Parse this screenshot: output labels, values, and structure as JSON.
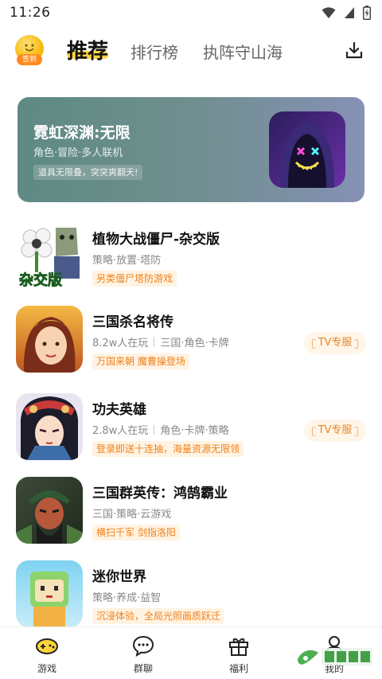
{
  "status_bar": {
    "time": "11:26",
    "icons": [
      "wifi-icon",
      "cellular-signal-icon",
      "battery-charging-icon"
    ]
  },
  "header": {
    "checkin_badge": "签到",
    "tabs": [
      {
        "label": "推荐",
        "active": true
      },
      {
        "label": "排行榜",
        "active": false
      },
      {
        "label": "执阵守山海",
        "active": false
      }
    ],
    "download_icon": "download-icon"
  },
  "banner": {
    "title": "霓虹深渊:无限",
    "subtitle": "角色·冒险·多人联机",
    "tag": "道具无限叠，突突爽翻天!"
  },
  "games": [
    {
      "title": "植物大战僵尸-杂交版",
      "meta": [
        "策略·放置·塔防"
      ],
      "tag": "另类僵尸塔防游戏",
      "badge": ""
    },
    {
      "title": "三国杀名将传",
      "meta": [
        "8.2w人在玩",
        "三国·角色·卡牌"
      ],
      "tag": "万国来朝 魔曹操登场",
      "badge": "TV专服"
    },
    {
      "title": "功夫英雄",
      "meta": [
        "2.8w人在玩",
        "角色·卡牌·策略"
      ],
      "tag": "登录即送十连抽，海量资源无限领",
      "badge": "TV专服"
    },
    {
      "title": "三国群英传：鸿鹄霸业",
      "meta": [
        "三国·策略·云游戏"
      ],
      "tag": "横扫千军 剑指洛阳",
      "badge": ""
    },
    {
      "title": "迷你世界",
      "meta": [
        "策略·养成·益智"
      ],
      "tag": "沉浸体验，全局光照画质跃迁",
      "badge": ""
    }
  ],
  "bottom_nav": [
    {
      "label": "游戏",
      "icon": "gamepad-icon",
      "active": true
    },
    {
      "label": "群聊",
      "icon": "chat-bubble-icon",
      "active": false
    },
    {
      "label": "福利",
      "icon": "gift-icon",
      "active": false
    },
    {
      "label": "我的",
      "icon": "user-icon",
      "active": false
    }
  ],
  "colors": {
    "accent": "#ffd43b",
    "tag_text": "#f0801a",
    "tag_bg": "#fff3e3",
    "banner_start": "#5f8a83",
    "banner_end": "#8691b6"
  }
}
